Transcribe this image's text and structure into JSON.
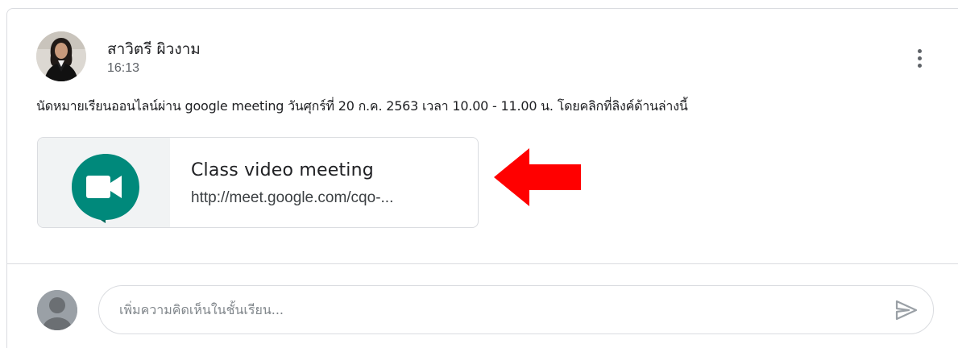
{
  "post": {
    "author": "สาวิตรี ผิวงาม",
    "time": "16:13",
    "text": "นัดหมายเรียนออนไลน์ผ่าน google meeting วันศุกร์ที่ 20 ก.ค. 2563 เวลา 10.00 - 11.00 น. โดยคลิกที่ลิงค์ด้านล่างนี้",
    "menu_icon": "more-vert-icon"
  },
  "attachment": {
    "title": "Class video meeting",
    "url": "http://meet.google.com/cqo-...",
    "icon": "google-meet-icon",
    "brand_color": "#00897B"
  },
  "annotation": {
    "icon": "red-arrow-icon",
    "color": "#FF0000"
  },
  "comment": {
    "placeholder": "เพิ่มความคิดเห็นในชั้นเรียน...",
    "value": "",
    "send_icon": "send-icon"
  }
}
